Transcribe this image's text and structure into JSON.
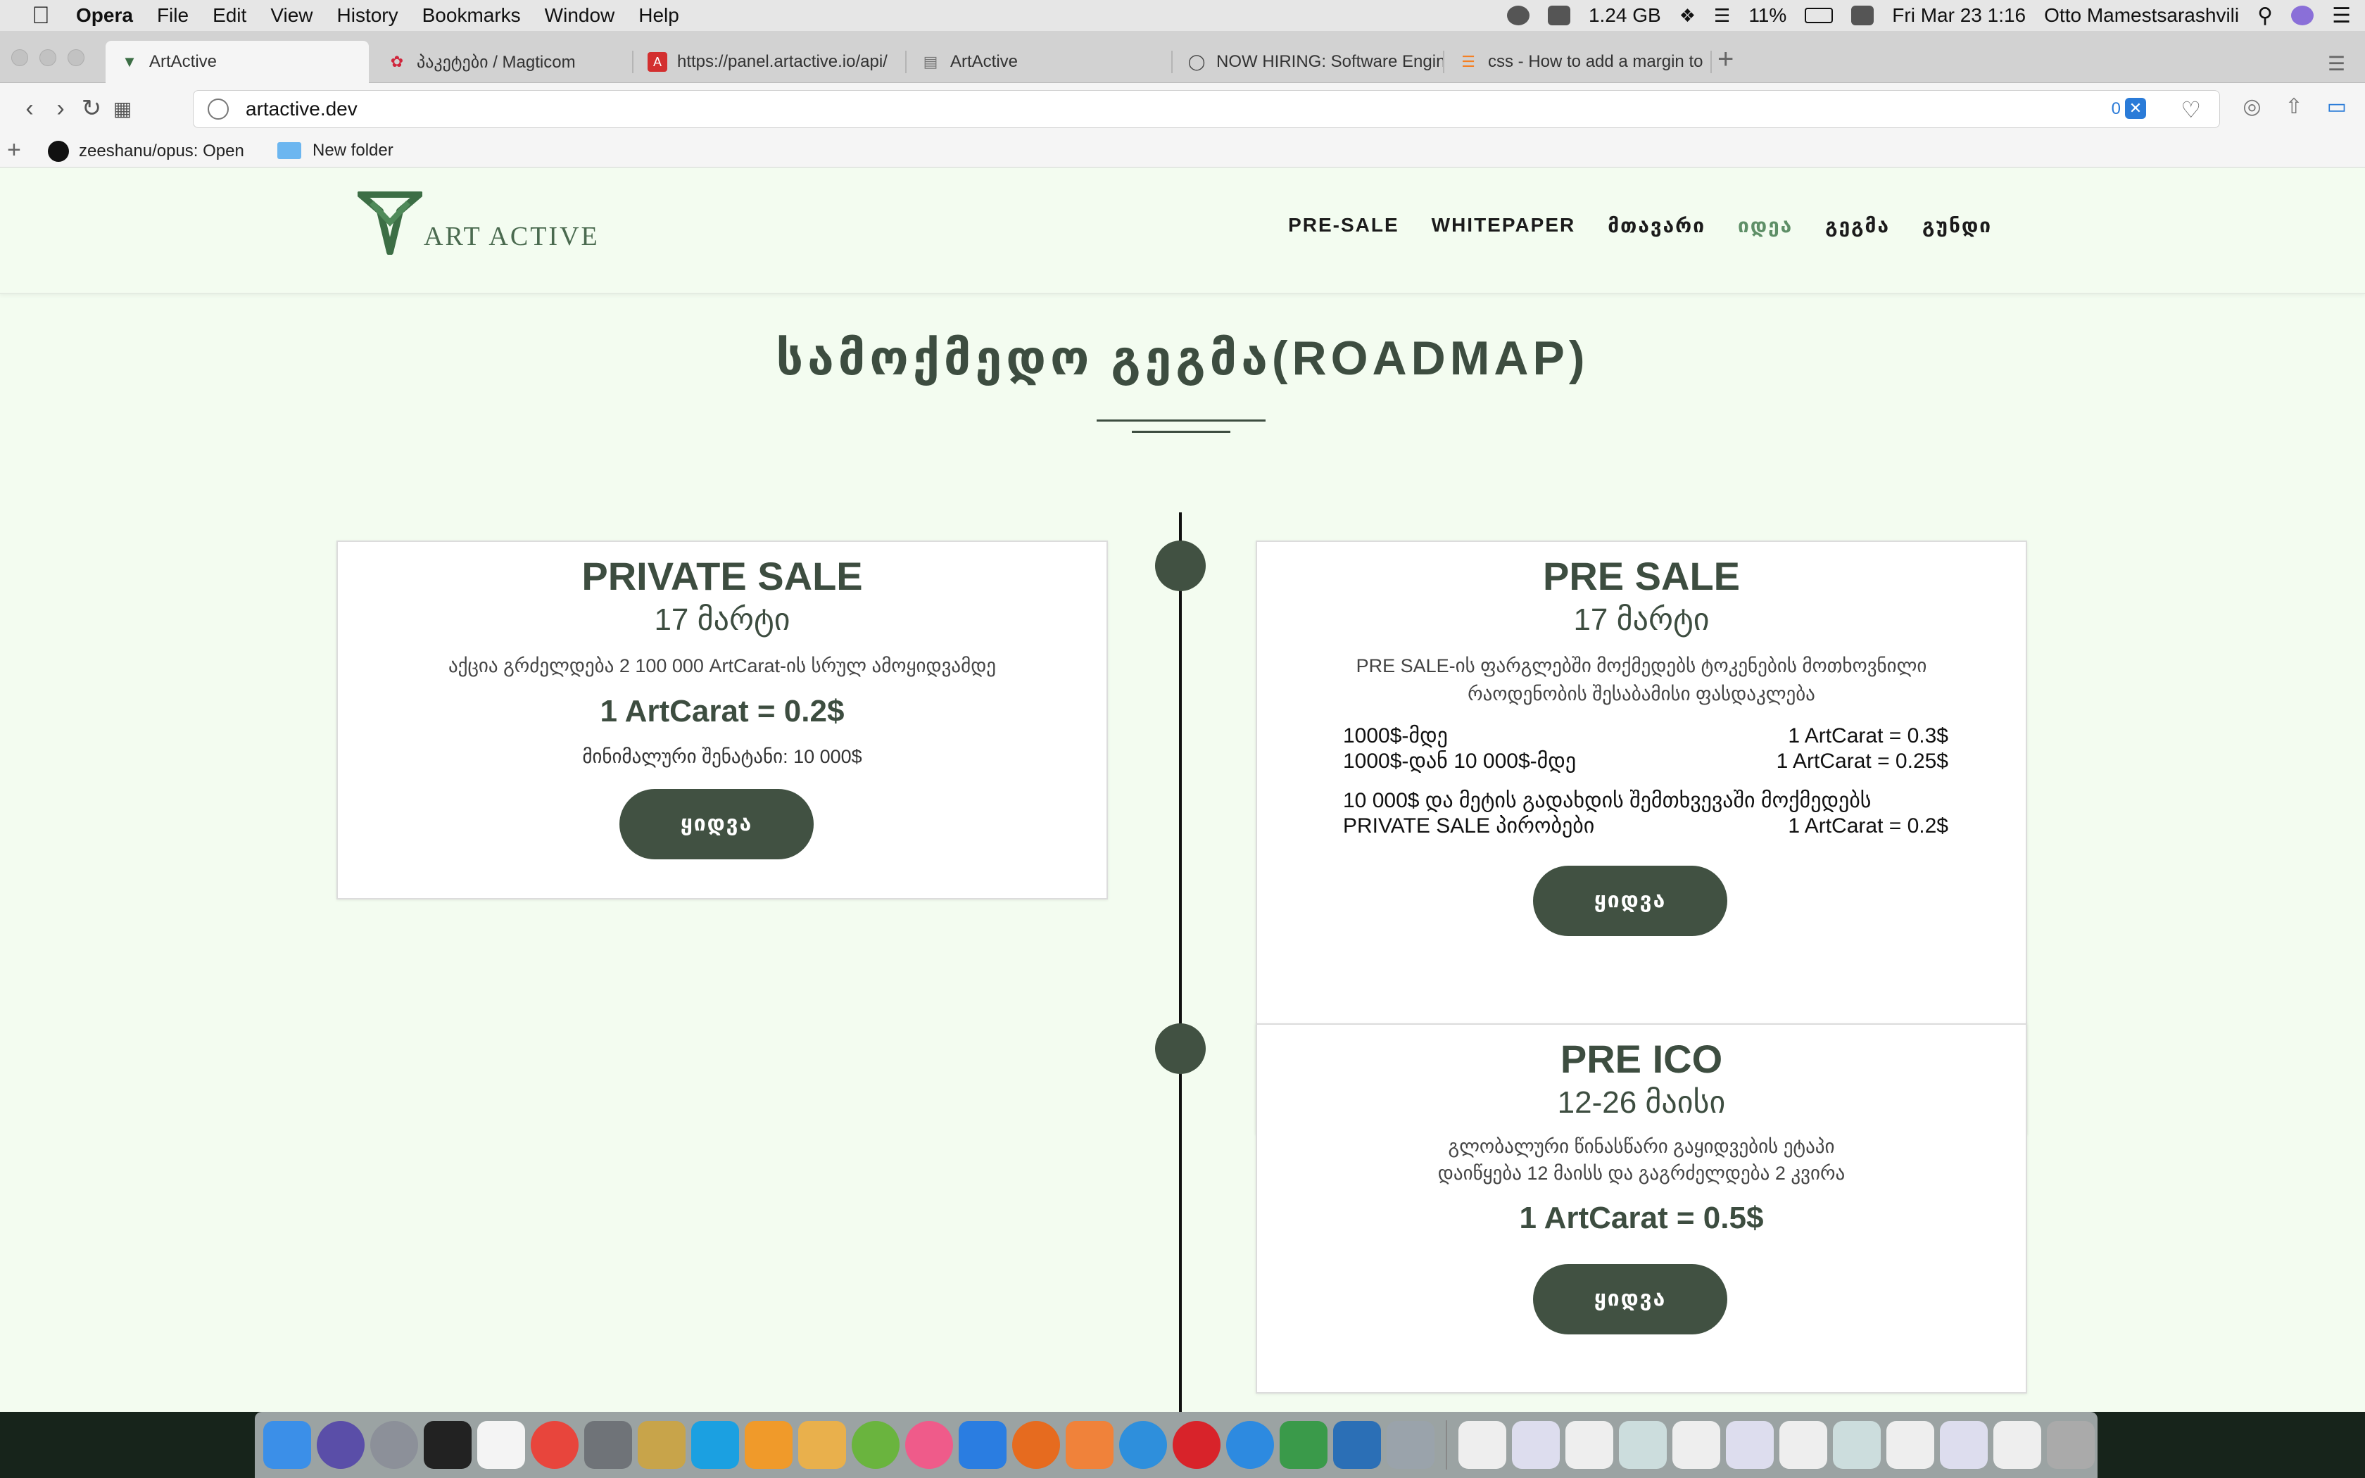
{
  "menubar": {
    "app": "Opera",
    "items": [
      "File",
      "Edit",
      "View",
      "History",
      "Bookmarks",
      "Window",
      "Help"
    ],
    "memory": "1.24 GB",
    "battery": "11%",
    "datetime": "Fri Mar 23  1:16",
    "user": "Otto Mamestsarashvili"
  },
  "tabs": [
    {
      "title": "ArtActive",
      "active": true
    },
    {
      "title": "პაკეტები / Magticom",
      "active": false
    },
    {
      "title": "https://panel.artactive.io/api/",
      "active": false
    },
    {
      "title": "ArtActive",
      "active": false
    },
    {
      "title": "NOW HIRING: Software Engin",
      "active": false
    },
    {
      "title": "css - How to add a margin to",
      "active": false
    }
  ],
  "address": {
    "url": "artactive.dev",
    "badge": "0"
  },
  "bookmarks": [
    {
      "label": "zeeshanu/opus: Open"
    },
    {
      "label": "New folder"
    }
  ],
  "site": {
    "brand": "ART ACTIVE",
    "nav": [
      {
        "label": "PRE-SALE",
        "active": false
      },
      {
        "label": "WHITEPAPER",
        "active": false
      },
      {
        "label": "მთავარი",
        "active": false
      },
      {
        "label": "იდეა",
        "active": true
      },
      {
        "label": "გეგმა",
        "active": false
      },
      {
        "label": "გუნდი",
        "active": false
      }
    ],
    "section_title": "სამოქმედო გეგმა(ROADMAP)",
    "private_sale": {
      "title": "PRIVATE SALE",
      "date": "17 მარტი",
      "description": "აქცია გრძელდება 2 100 000 ArtCarat-ის სრულ ამოყიდვამდე",
      "price": "1 ArtCarat = 0.2$",
      "minimum": "მინიმალური შენატანი: 10 000$",
      "button": "ყიდვა"
    },
    "pre_sale": {
      "title": "PRE SALE",
      "date": "17 მარტი",
      "description": "PRE SALE-ის ფარგლებში მოქმედებს ტოკენების მოთხოვნილი რაოდენობის შესაბამისი ფასდაკლება",
      "tiers": [
        {
          "range": "1000$-მდე",
          "price": "1 ArtCarat = 0.3$"
        },
        {
          "range": "1000$-დან 10 000$-მდე",
          "price": "1 ArtCarat = 0.25$"
        }
      ],
      "note_line1": "10 000$ და მეტის გადახდის შემთხვევაში მოქმედებს",
      "note_line2": "PRIVATE SALE პირობები",
      "note_price": "1 ArtCarat = 0.2$",
      "button": "ყიდვა"
    },
    "pre_ico": {
      "title": "PRE ICO",
      "date": "12-26 მაისი",
      "description_line1": "გლობალური წინასწარი გაყიდვების ეტაპი",
      "description_line2": "დაიწყება 12 მაისს და გაგრძელდება 2 კვირა",
      "price": "1 ArtCarat = 0.5$",
      "button": "ყიდვა"
    }
  },
  "colors": {
    "accent": "#415142",
    "page_bg": "#f3fcf0",
    "nav_active": "#5e8f67"
  }
}
